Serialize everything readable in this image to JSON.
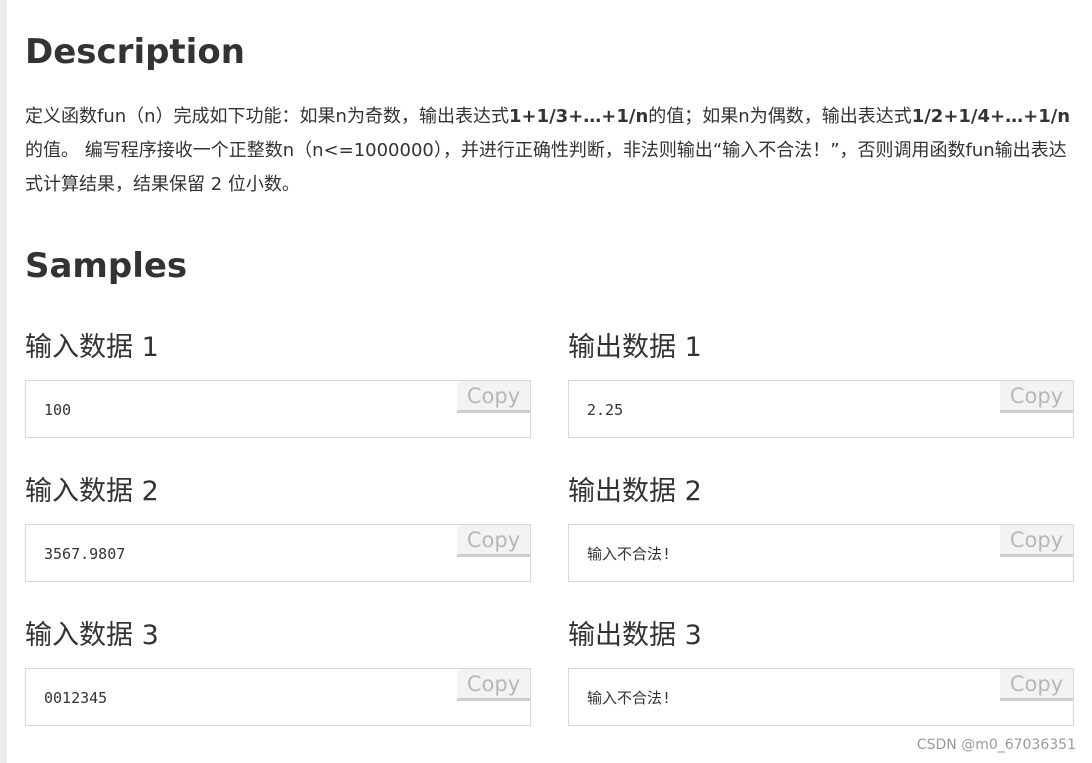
{
  "description": {
    "title": "Description",
    "paragraph": [
      {
        "text": "定义函数fun（n）完成如下功能：如果n为奇数，输出表达式",
        "bold": false
      },
      {
        "text": "1+1/3+…+1/n",
        "bold": true
      },
      {
        "text": "的值；如果n为偶数，输出表达式",
        "bold": false
      },
      {
        "text": "1/2+1/4+…+1/n",
        "bold": true
      },
      {
        "text": "的值。 编写程序接收一个正整数n（n<=1000000），并进行正确性判断，非法则输出“输入不合法！”，否则调用函数fun输出表达式计算结果，结果保留 2 位小数。",
        "bold": false
      }
    ]
  },
  "samples": {
    "title": "Samples",
    "copy_label": "Copy",
    "items": [
      {
        "input_label": "输入数据 1",
        "input_value": "100",
        "output_label": "输出数据 1",
        "output_value": "2.25"
      },
      {
        "input_label": "输入数据 2",
        "input_value": "3567.9807",
        "output_label": "输出数据 2",
        "output_value": "输入不合法!"
      },
      {
        "input_label": "输入数据 3",
        "input_value": "0012345",
        "output_label": "输出数据 3",
        "output_value": "输入不合法!"
      }
    ]
  },
  "watermark": "CSDN @m0_67036351"
}
